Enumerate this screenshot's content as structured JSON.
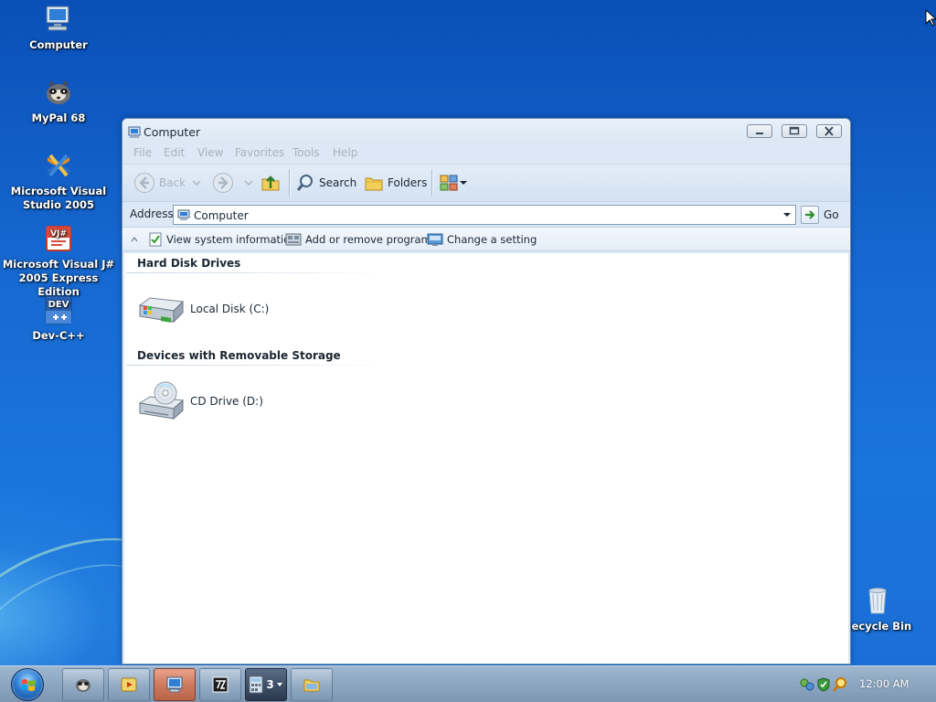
{
  "desktop": {
    "icons": [
      {
        "label": "Computer",
        "icon": "computer-icon"
      },
      {
        "label": "MyPal 68",
        "icon": "mypal-icon"
      },
      {
        "label": "Microsoft Visual Studio 2005",
        "icon": "visual-studio-icon"
      },
      {
        "label": "Microsoft Visual J# 2005 Express Edition",
        "icon": "visual-jsharp-icon"
      },
      {
        "label": "Dev-C++",
        "icon": "dev-cpp-icon"
      },
      {
        "label": "Recycle Bin",
        "icon": "recycle-bin-icon"
      }
    ],
    "icon_badges": {
      "dev": "DEV",
      "vj": "VJ#"
    }
  },
  "window": {
    "title": "Computer",
    "menu": [
      "File",
      "Edit",
      "View",
      "Favorites",
      "Tools",
      "Help"
    ],
    "toolbar": {
      "back_label": "Back",
      "search_label": "Search",
      "folders_label": "Folders"
    },
    "address": {
      "label": "Address",
      "value": "Computer",
      "go_label": "Go"
    },
    "tasks": [
      {
        "label": "View system information",
        "icon": "checklist-icon"
      },
      {
        "label": "Add or remove programs",
        "icon": "programs-icon"
      },
      {
        "label": "Change a setting",
        "icon": "control-panel-icon"
      }
    ],
    "groups": [
      {
        "heading": "Hard Disk Drives",
        "items": [
          {
            "label": "Local Disk (C:)",
            "icon": "hard-disk-icon"
          }
        ]
      },
      {
        "heading": "Devices with Removable Storage",
        "items": [
          {
            "label": "CD Drive (D:)",
            "icon": "cd-drive-icon"
          }
        ]
      }
    ]
  },
  "taskbar": {
    "apps": [
      {
        "name": "mypal",
        "icon": "mypal-icon"
      },
      {
        "name": "media",
        "icon": "media-player-icon"
      },
      {
        "name": "computer",
        "icon": "computer-icon",
        "active": true
      },
      {
        "name": "7zip",
        "icon": "7zip-icon"
      },
      {
        "name": "calculator",
        "icon": "calculator-icon",
        "count": "3"
      },
      {
        "name": "explorer",
        "icon": "explorer-icon"
      }
    ],
    "clock": "12:00 AM"
  },
  "colors": {
    "desktop_blue": "#1668d0",
    "window_frame": "#dce8f5",
    "active_task": "#cf7a5e"
  }
}
